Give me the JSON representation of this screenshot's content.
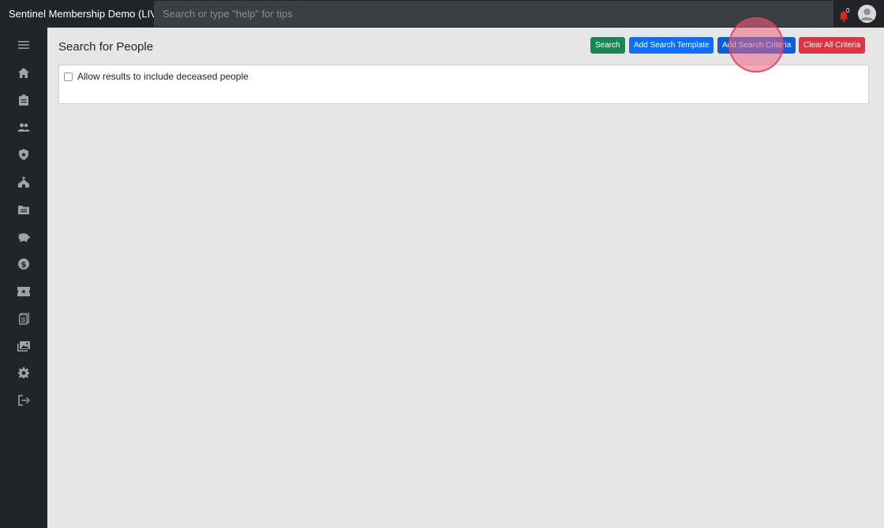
{
  "topbar": {
    "app_title": "Sentinel Membership Demo (LIVE)",
    "search_placeholder": "Search or type \"help\" for tips",
    "notification_count": "0"
  },
  "sidebar": {
    "items": [
      {
        "icon": "menu-icon"
      },
      {
        "icon": "home-icon"
      },
      {
        "icon": "clipboard-icon"
      },
      {
        "icon": "people-icon"
      },
      {
        "icon": "shield-icon"
      },
      {
        "icon": "church-icon"
      },
      {
        "icon": "folder-icon"
      },
      {
        "icon": "piggy-bank-icon"
      },
      {
        "icon": "dollar-icon"
      },
      {
        "icon": "ticket-icon"
      },
      {
        "icon": "documents-icon"
      },
      {
        "icon": "photos-icon"
      },
      {
        "icon": "gear-icon"
      },
      {
        "icon": "logout-icon"
      }
    ]
  },
  "main": {
    "title": "Search for People",
    "buttons": {
      "search": "Search",
      "add_template": "Add Search Template",
      "add_criteria": "Add Search Criteria",
      "clear_all": "Clear All Criteria"
    },
    "checkbox_label": "Allow results to include deceased people",
    "checkbox_checked": false
  },
  "colors": {
    "topbar_bg": "#212529",
    "search_bg": "#3c3f42",
    "main_bg": "#e6e6e6",
    "btn_green": "#198754",
    "btn_blue": "#0d6efd",
    "btn_red": "#dc3545",
    "bell": "#e02424"
  }
}
